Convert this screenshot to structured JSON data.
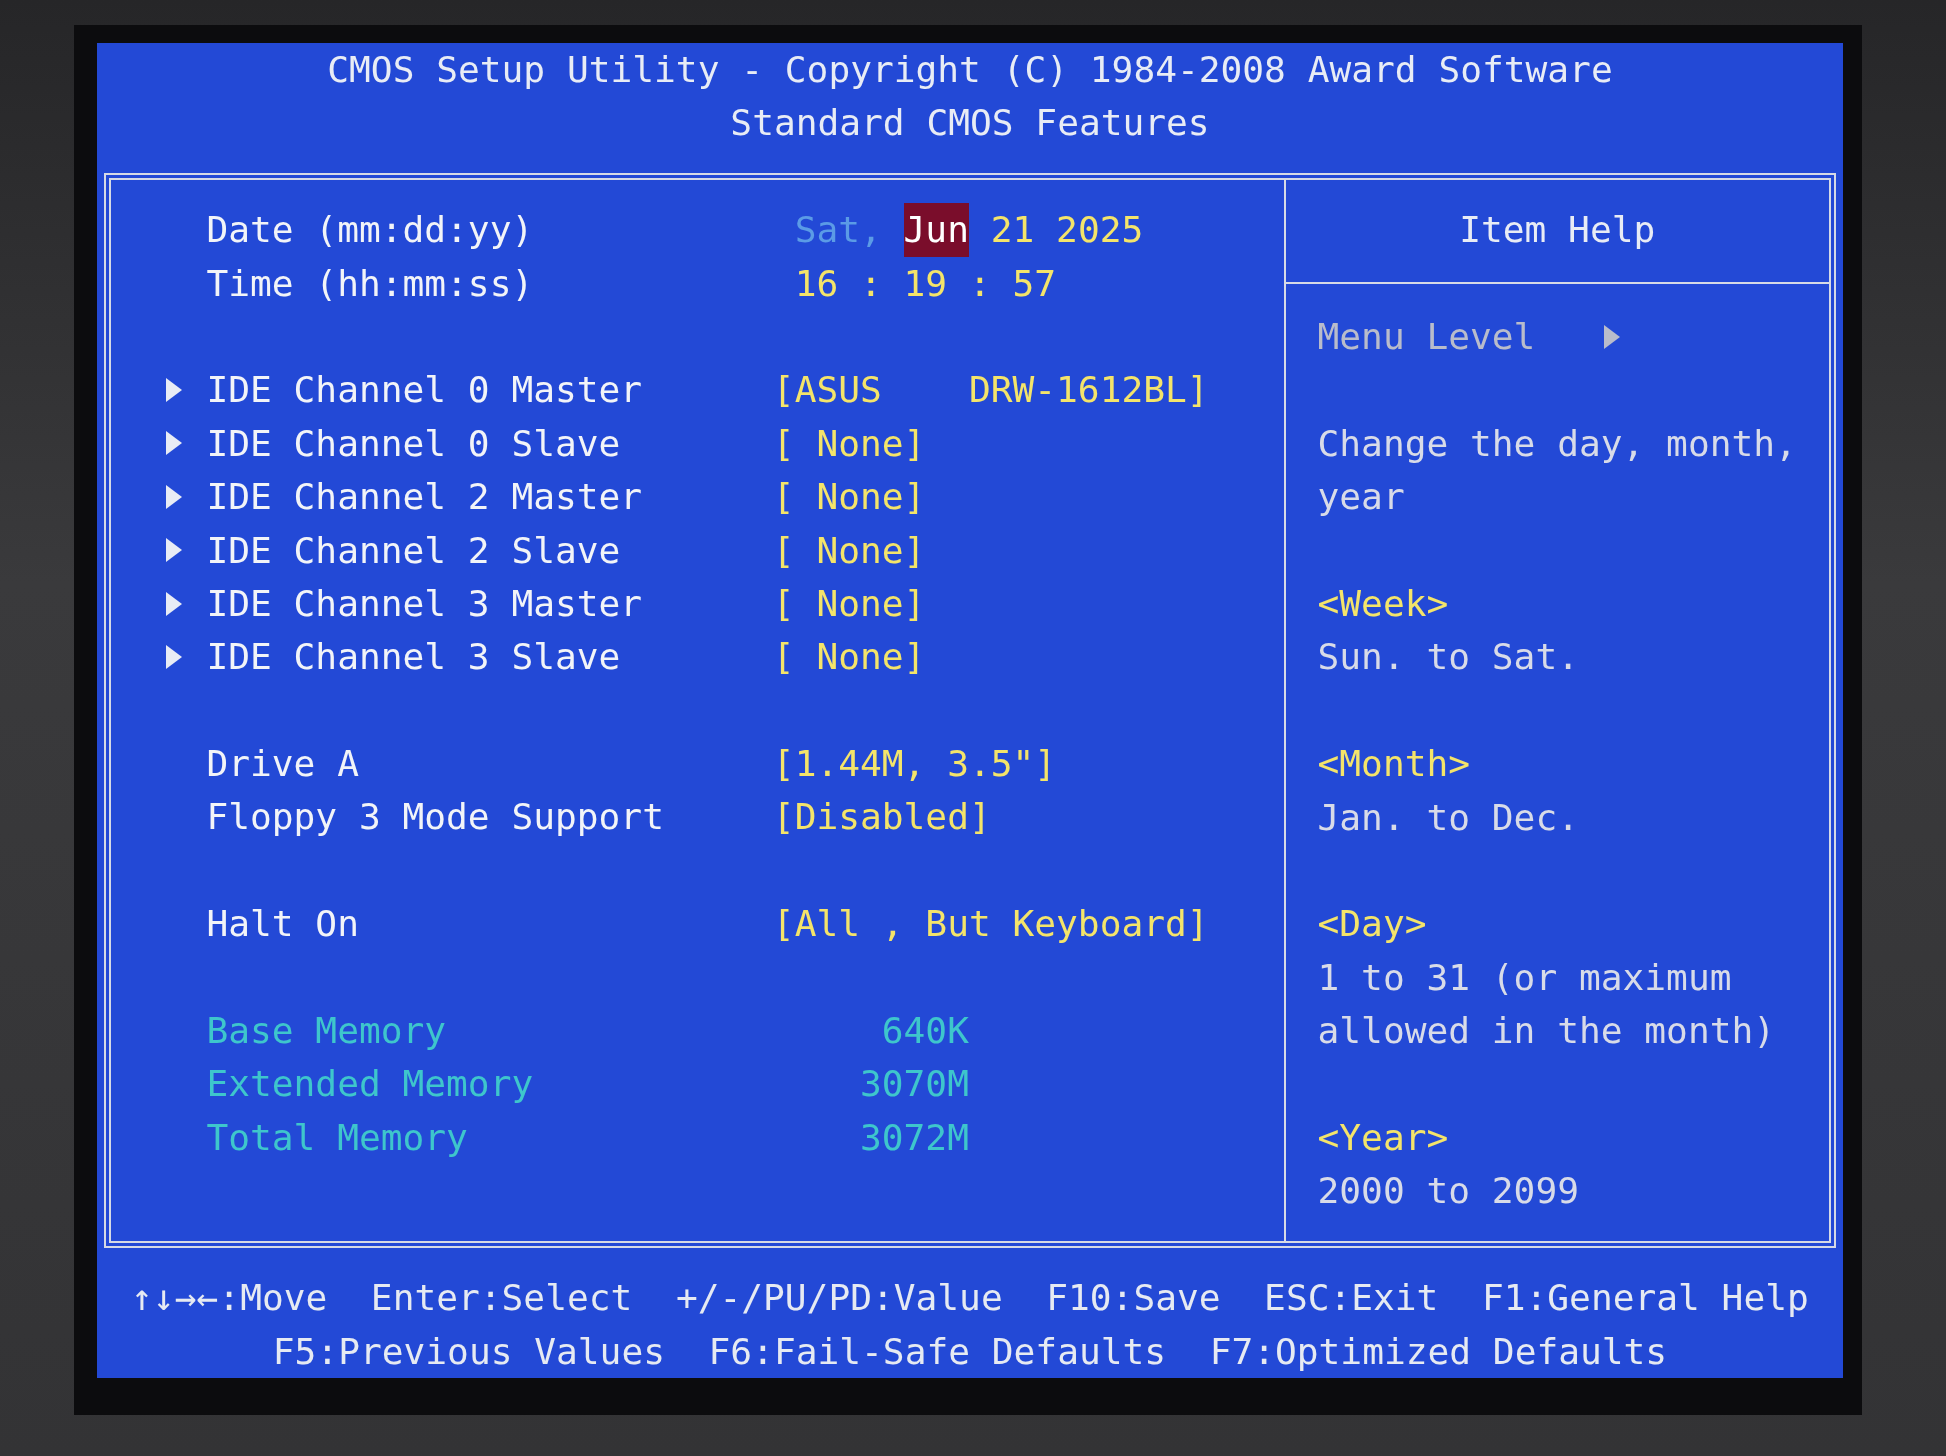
{
  "header": {
    "title": "CMOS Setup Utility - Copyright (C) 1984-2008 Award Software",
    "subtitle": "Standard CMOS Features"
  },
  "settings": {
    "date": {
      "label": "Date (mm:dd:yy)",
      "weekday": "Sat,",
      "fields": [
        {
          "text": "Jun",
          "selected": true
        },
        {
          "text": "21",
          "selected": false
        },
        {
          "text": "2025",
          "selected": false
        }
      ]
    },
    "time": {
      "label": "Time (hh:mm:ss)",
      "fields": [
        {
          "text": "16",
          "selected": false
        },
        {
          "text": "19",
          "selected": false
        },
        {
          "text": "57",
          "selected": false
        }
      ],
      "separators": [
        ":",
        ":"
      ]
    },
    "groups": [
      {
        "items": [
          {
            "kind": "submenu",
            "label": "IDE Channel 0 Master",
            "value": "[ASUS    DRW-1612BL]"
          },
          {
            "kind": "submenu",
            "label": "IDE Channel 0 Slave",
            "value": "[ None]"
          },
          {
            "kind": "submenu",
            "label": "IDE Channel 2 Master",
            "value": "[ None]"
          },
          {
            "kind": "submenu",
            "label": "IDE Channel 2 Slave",
            "value": "[ None]"
          },
          {
            "kind": "submenu",
            "label": "IDE Channel 3 Master",
            "value": "[ None]"
          },
          {
            "kind": "submenu",
            "label": "IDE Channel 3 Slave",
            "value": "[ None]"
          }
        ]
      },
      {
        "items": [
          {
            "kind": "option",
            "label": "Drive A",
            "value": "[1.44M, 3.5\"]"
          },
          {
            "kind": "option",
            "label": "Floppy 3 Mode Support",
            "value": "[Disabled]"
          }
        ]
      },
      {
        "items": [
          {
            "kind": "option",
            "label": "Halt On",
            "value": "[All , But Keyboard]"
          }
        ]
      },
      {
        "items": [
          {
            "kind": "info",
            "label": "Base Memory",
            "value": "640K"
          },
          {
            "kind": "info",
            "label": "Extended Memory",
            "value": "3070M"
          },
          {
            "kind": "info",
            "label": "Total Memory",
            "value": "3072M"
          }
        ]
      }
    ]
  },
  "item_help": {
    "title": "Item Help",
    "menu_level": "Menu Level",
    "description": "Change the day, month, year",
    "entries": [
      {
        "heading": "<Week>",
        "text": "Sun. to Sat."
      },
      {
        "heading": "<Month>",
        "text": "Jan. to Dec."
      },
      {
        "heading": "<Day>",
        "text": "1 to 31 (or maximum allowed in the month)"
      },
      {
        "heading": "<Year>",
        "text": "2000 to 2099"
      }
    ]
  },
  "key_hints": [
    [
      "↑↓→←:Move",
      "Enter:Select",
      "+/-/PU/PD:Value",
      "F10:Save",
      "ESC:Exit",
      "F1:General Help"
    ],
    [
      "F5:Previous Values",
      "F6:Fail-Safe Defaults",
      "F7:Optimized Defaults"
    ]
  ]
}
